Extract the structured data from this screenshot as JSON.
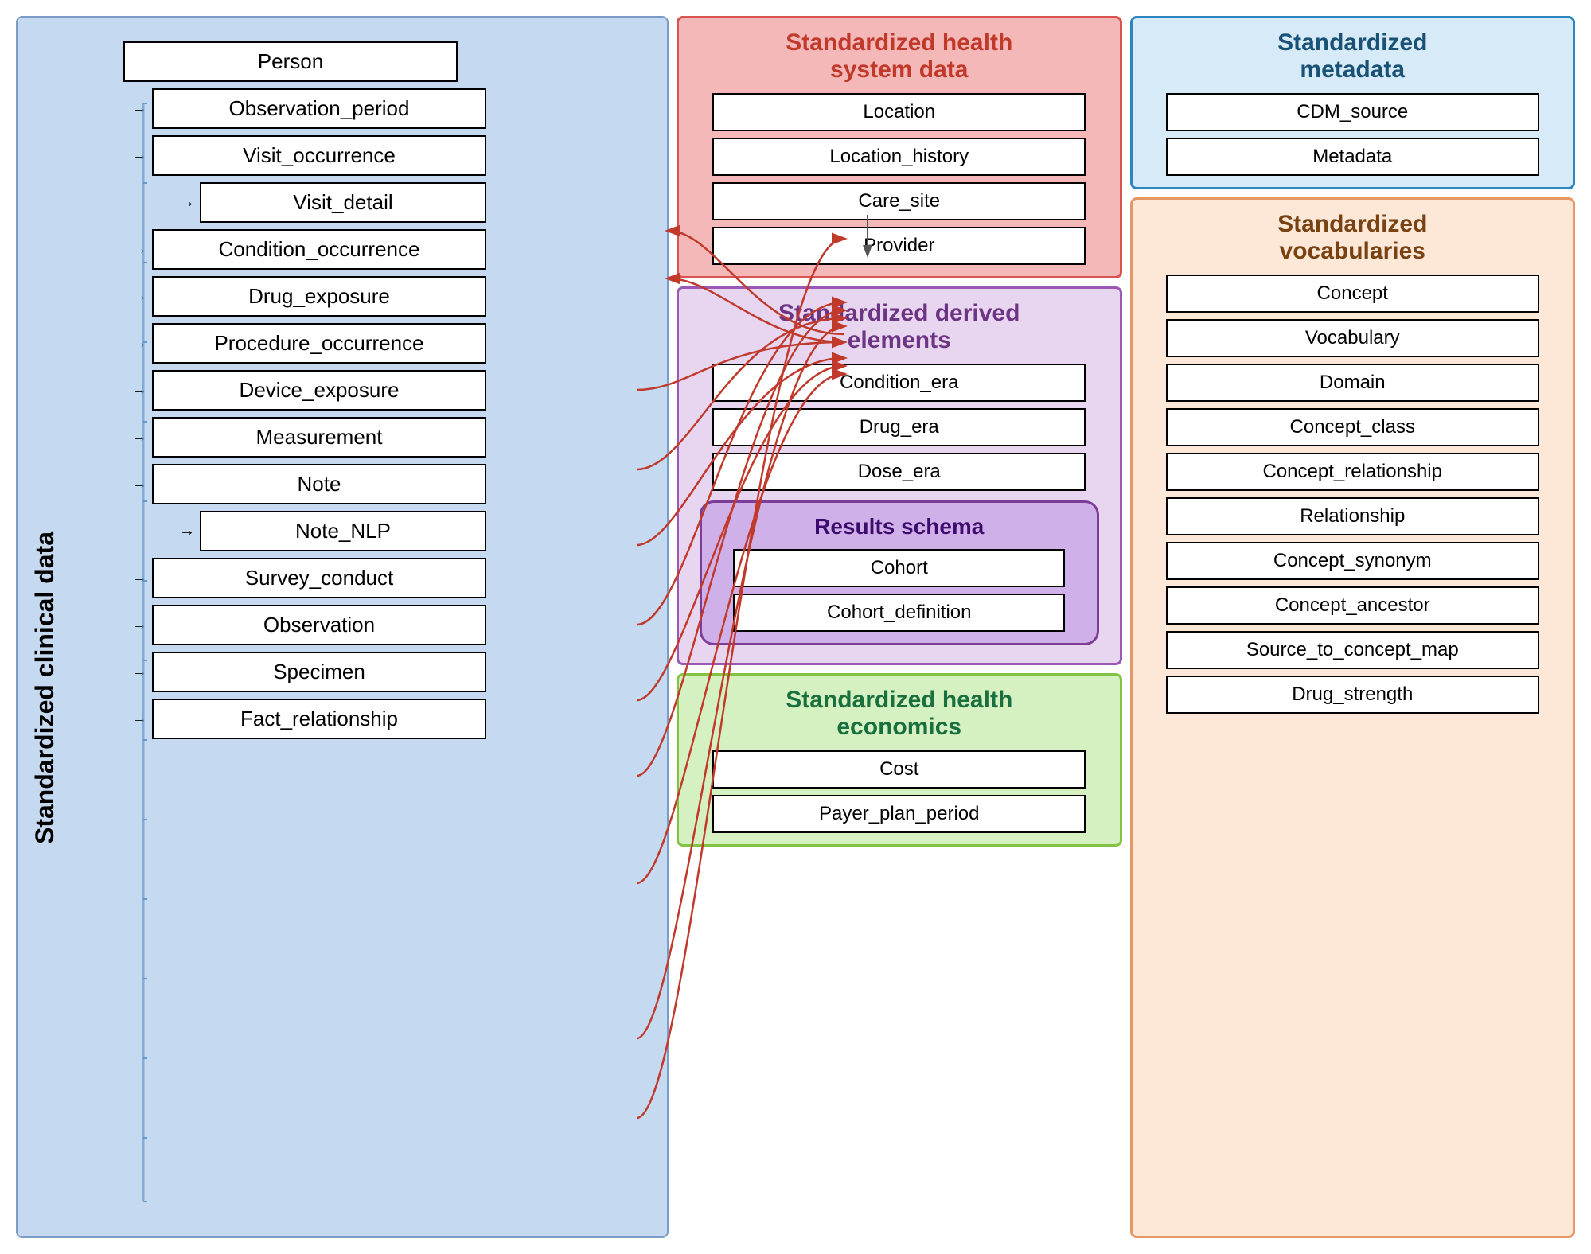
{
  "left_panel": {
    "title": "Standardized clinical data",
    "nodes": [
      {
        "id": "person",
        "label": "Person",
        "indent": 0
      },
      {
        "id": "observation_period",
        "label": "Observation_period",
        "indent": 1
      },
      {
        "id": "visit_occurrence",
        "label": "Visit_occurrence",
        "indent": 1
      },
      {
        "id": "visit_detail",
        "label": "Visit_detail",
        "indent": 2
      },
      {
        "id": "condition_occurrence",
        "label": "Condition_occurrence",
        "indent": 1
      },
      {
        "id": "drug_exposure",
        "label": "Drug_exposure",
        "indent": 1
      },
      {
        "id": "procedure_occurrence",
        "label": "Procedure_occurrence",
        "indent": 1
      },
      {
        "id": "device_exposure",
        "label": "Device_exposure",
        "indent": 1
      },
      {
        "id": "measurement",
        "label": "Measurement",
        "indent": 1
      },
      {
        "id": "note",
        "label": "Note",
        "indent": 1
      },
      {
        "id": "note_nlp",
        "label": "Note_NLP",
        "indent": 2
      },
      {
        "id": "survey_conduct",
        "label": "Survey_conduct",
        "indent": 1
      },
      {
        "id": "observation",
        "label": "Observation",
        "indent": 1
      },
      {
        "id": "specimen",
        "label": "Specimen",
        "indent": 1
      },
      {
        "id": "fact_relationship",
        "label": "Fact_relationship",
        "indent": 1
      }
    ]
  },
  "health_system": {
    "title": "Standardized health\nsystem data",
    "nodes": [
      {
        "id": "location",
        "label": "Location"
      },
      {
        "id": "location_history",
        "label": "Location_history"
      },
      {
        "id": "care_site",
        "label": "Care_site"
      },
      {
        "id": "provider",
        "label": "Provider"
      }
    ]
  },
  "derived_elements": {
    "title": "Standardized derived\nelements",
    "nodes": [
      {
        "id": "condition_era",
        "label": "Condition_era"
      },
      {
        "id": "drug_era",
        "label": "Drug_era"
      },
      {
        "id": "dose_era",
        "label": "Dose_era"
      }
    ]
  },
  "results_schema": {
    "title": "Results schema",
    "nodes": [
      {
        "id": "cohort",
        "label": "Cohort"
      },
      {
        "id": "cohort_definition",
        "label": "Cohort_definition"
      }
    ]
  },
  "health_economics": {
    "title": "Standardized health\neconomics",
    "nodes": [
      {
        "id": "cost",
        "label": "Cost"
      },
      {
        "id": "payer_plan_period",
        "label": "Payer_plan_period"
      }
    ]
  },
  "metadata": {
    "title": "Standardized\nmetadata",
    "nodes": [
      {
        "id": "cdm_source",
        "label": "CDM_source"
      },
      {
        "id": "metadata",
        "label": "Metadata"
      }
    ]
  },
  "vocabularies": {
    "title": "Standardized\nvocabularies",
    "nodes": [
      {
        "id": "concept",
        "label": "Concept"
      },
      {
        "id": "vocabulary",
        "label": "Vocabulary"
      },
      {
        "id": "domain",
        "label": "Domain"
      },
      {
        "id": "concept_class",
        "label": "Concept_class"
      },
      {
        "id": "concept_relationship",
        "label": "Concept_relationship"
      },
      {
        "id": "relationship",
        "label": "Relationship"
      },
      {
        "id": "concept_synonym",
        "label": "Concept_synonym"
      },
      {
        "id": "concept_ancestor",
        "label": "Concept_ancestor"
      },
      {
        "id": "source_to_concept_map",
        "label": "Source_to_concept_map"
      },
      {
        "id": "drug_strength",
        "label": "Drug_strength"
      }
    ]
  }
}
